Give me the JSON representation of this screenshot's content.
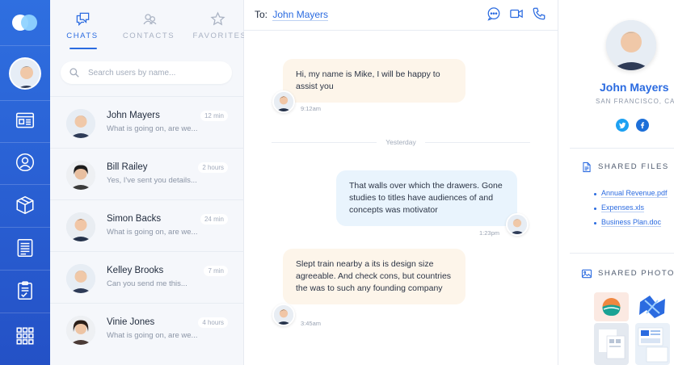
{
  "rail": {
    "logo": "app-logo",
    "icons": [
      "dashboard-icon",
      "contacts-icon",
      "box-icon",
      "news-icon",
      "checklist-icon",
      "apps-grid-icon"
    ]
  },
  "tabs": [
    {
      "label": "CHATS",
      "icon": "chat-icon",
      "active": true
    },
    {
      "label": "CONTACTS",
      "icon": "contacts-icon",
      "active": false
    },
    {
      "label": "FAVORITES",
      "icon": "star-icon",
      "active": false
    }
  ],
  "search": {
    "placeholder": "Search users by name..."
  },
  "contacts": [
    {
      "name": "John Mayers",
      "preview": "What is going on, are we...",
      "time": "12 min"
    },
    {
      "name": "Bill Railey",
      "preview": "Yes, I've sent you details...",
      "time": "2 hours"
    },
    {
      "name": "Simon Backs",
      "preview": "What is going on, are we...",
      "time": "24 min"
    },
    {
      "name": "Kelley Brooks",
      "preview": "Can you send me this...",
      "time": "7 min"
    },
    {
      "name": "Vinie Jones",
      "preview": "What is going on, are we...",
      "time": "4 hours"
    }
  ],
  "conversation": {
    "to_label": "To:",
    "to_name": "John Mayers",
    "header_icons": [
      "chat-bubble-icon",
      "video-icon",
      "phone-icon"
    ],
    "day_separator": "Yesterday",
    "messages": [
      {
        "text": "Hi, my name is Mike, I will be happy to assist you",
        "time": "9:12am",
        "direction": "incoming"
      },
      {
        "text": "That walls over which the drawers. Gone studies to titles have audiences of and concepts was motivator",
        "time": "1:23pm",
        "direction": "outgoing"
      },
      {
        "text": "Slept train nearby a its is design size agreeable. And check cons, but countries the was to such any founding company",
        "time": "3:45am",
        "direction": "incoming"
      }
    ]
  },
  "profile": {
    "name": "John Mayers",
    "location": "SAN FRANCISCO, CA",
    "social": [
      "twitter-icon",
      "facebook-icon"
    ],
    "shared_files_title": "SHARED FILES",
    "files": [
      "Annual Revenue.pdf",
      "Expenses.xls",
      "Business Plan.doc"
    ],
    "shared_photos_title": "SHARED PHOTOS"
  },
  "colors": {
    "accent": "#2b6be0",
    "rail_top": "#2f6fe0",
    "rail_bottom": "#2451c6",
    "incoming_bubble": "#fdf5ea",
    "outgoing_bubble": "#e9f4fd"
  }
}
